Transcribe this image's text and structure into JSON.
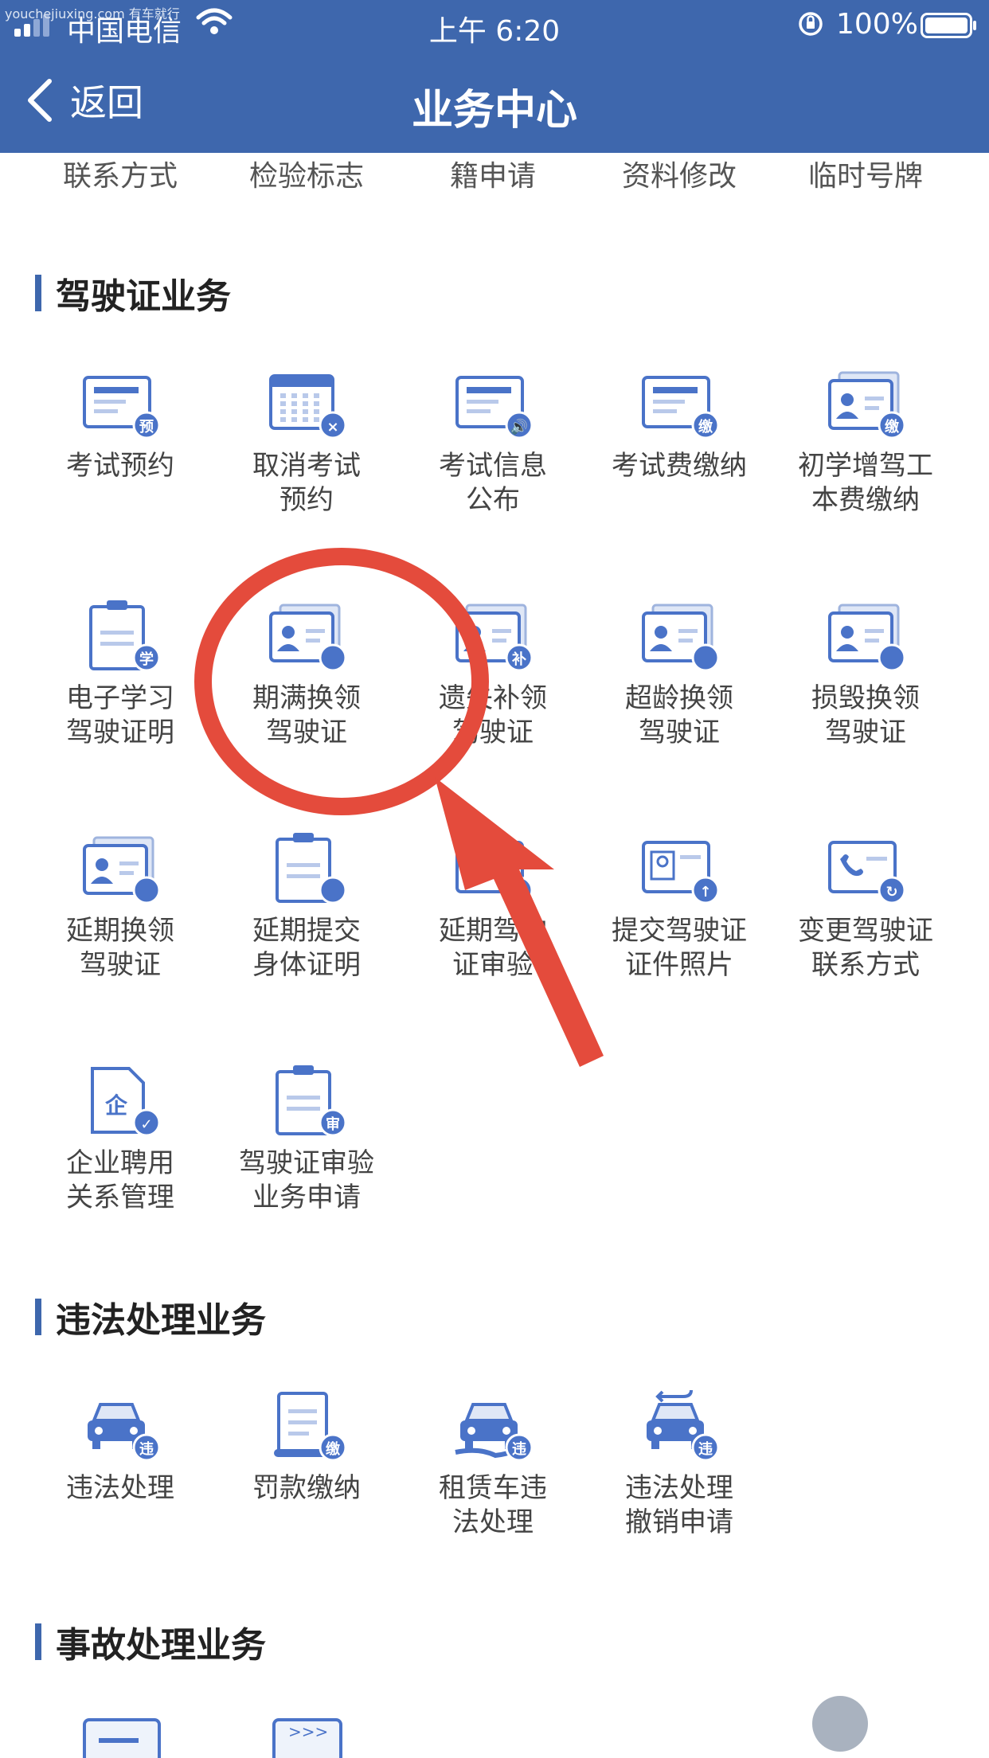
{
  "watermark": "youchejiuxing.com 有车就行",
  "status_bar": {
    "carrier": "中国电信",
    "time": "上午 6:20",
    "battery": "100%"
  },
  "nav": {
    "back_label": "返回",
    "title": "业务中心"
  },
  "top_row": [
    "联系方式",
    "检验标志",
    "籍申请",
    "资料修改",
    "临时号牌"
  ],
  "sections": {
    "license": {
      "title": "驾驶证业务",
      "items": [
        {
          "line1": "考试预约",
          "line2": "",
          "badge": "预",
          "icon": "card-icon"
        },
        {
          "line1": "取消考试",
          "line2": "预约",
          "badge": "×",
          "icon": "calendar-icon"
        },
        {
          "line1": "考试信息",
          "line2": "公布",
          "badge": "🔊",
          "icon": "card-icon"
        },
        {
          "line1": "考试费缴纳",
          "line2": "",
          "badge": "缴",
          "icon": "card-icon"
        },
        {
          "line1": "初学增驾工",
          "line2": "本费缴纳",
          "badge": "缴",
          "icon": "id-card-icon"
        },
        {
          "line1": "电子学习",
          "line2": "驾驶证明",
          "badge": "学",
          "icon": "clipboard-icon"
        },
        {
          "line1": "期满换领",
          "line2": "驾驶证",
          "badge": "",
          "icon": "id-card-icon"
        },
        {
          "line1": "遗失补领",
          "line2": "驾驶证",
          "badge": "补",
          "icon": "id-card-icon"
        },
        {
          "line1": "超龄换领",
          "line2": "驾驶证",
          "badge": "",
          "icon": "id-card-icon"
        },
        {
          "line1": "损毁换领",
          "line2": "驾驶证",
          "badge": "",
          "icon": "id-card-icon"
        },
        {
          "line1": "延期换领",
          "line2": "驾驶证",
          "badge": "",
          "icon": "id-card-icon"
        },
        {
          "line1": "延期提交",
          "line2": "身体证明",
          "badge": "",
          "icon": "clipboard-icon"
        },
        {
          "line1": "延期驾驶",
          "line2": "证审验",
          "badge": "",
          "icon": "card-icon"
        },
        {
          "line1": "提交驾驶证",
          "line2": "证件照片",
          "badge": "↑",
          "icon": "photo-card-icon"
        },
        {
          "line1": "变更驾驶证",
          "line2": "联系方式",
          "badge": "↻",
          "icon": "phone-card-icon"
        },
        {
          "line1": "企业聘用",
          "line2": "关系管理",
          "badge": "✓",
          "icon": "document-icon"
        },
        {
          "line1": "驾驶证审验",
          "line2": "业务申请",
          "badge": "审",
          "icon": "clipboard-icon"
        }
      ]
    },
    "violation": {
      "title": "违法处理业务",
      "items": [
        {
          "line1": "违法处理",
          "line2": "",
          "badge": "违",
          "icon": "car-icon"
        },
        {
          "line1": "罚款缴纳",
          "line2": "",
          "badge": "缴",
          "icon": "scroll-icon"
        },
        {
          "line1": "租赁车违",
          "line2": "法处理",
          "badge": "违",
          "icon": "car-hand-icon"
        },
        {
          "line1": "违法处理",
          "line2": "撤销申请",
          "badge": "违",
          "icon": "car-undo-icon"
        }
      ]
    },
    "accident": {
      "title": "事故处理业务"
    }
  },
  "colors": {
    "primary": "#3e67ad",
    "icon_blue": "#4a73c8",
    "annotation_red": "#e44b3c"
  }
}
